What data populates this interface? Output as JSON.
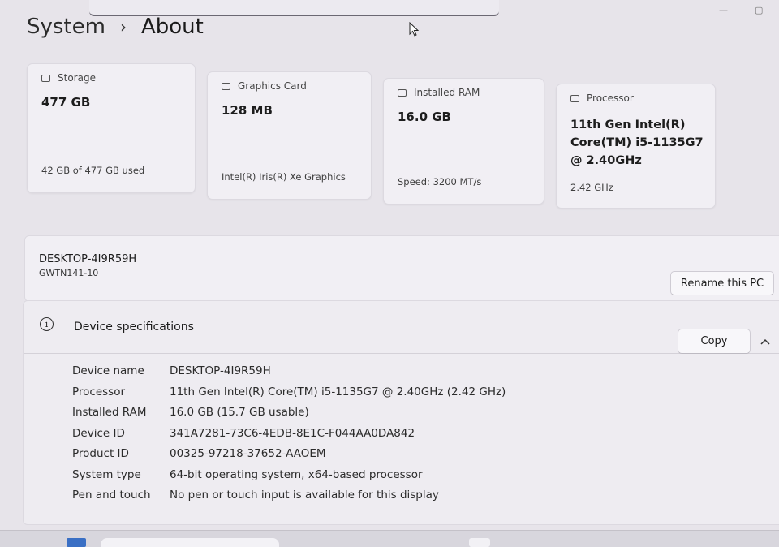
{
  "header": {
    "breadcrumb_parent": "System",
    "breadcrumb_separator": "›",
    "page_title": "About"
  },
  "window_controls": {
    "minimize": "—",
    "maximize": "▢"
  },
  "cards": [
    {
      "icon": "storage-icon",
      "label": "Storage",
      "value": "477 GB",
      "sub": "42 GB of 477 GB used"
    },
    {
      "icon": "graphics-card-icon",
      "label": "Graphics Card",
      "value": "128 MB",
      "sub": "Intel(R) Iris(R) Xe Graphics"
    },
    {
      "icon": "ram-icon",
      "label": "Installed RAM",
      "value": "16.0 GB",
      "sub": "Speed: 3200 MT/s"
    },
    {
      "icon": "processor-icon",
      "label": "Processor",
      "value": "11th Gen Intel(R) Core(TM) i5-1135G7 @ 2.40GHz",
      "sub": "2.42 GHz"
    }
  ],
  "pc": {
    "name": "DESKTOP-4I9R59H",
    "model": "GWTN141-10",
    "rename_label": "Rename this PC"
  },
  "device_specs": {
    "title": "Device specifications",
    "copy_label": "Copy",
    "rows": [
      {
        "label": "Device name",
        "value": "DESKTOP-4I9R59H"
      },
      {
        "label": "Processor",
        "value": "11th Gen Intel(R) Core(TM) i5-1135G7 @ 2.40GHz (2.42 GHz)"
      },
      {
        "label": "Installed RAM",
        "value": "16.0 GB (15.7 GB usable)"
      },
      {
        "label": "Device ID",
        "value": "341A7281-73C6-4EDB-8E1C-F044AA0DA842"
      },
      {
        "label": "Product ID",
        "value": "00325-97218-37652-AAOEM"
      },
      {
        "label": "System type",
        "value": "64-bit operating system, x64-based processor"
      },
      {
        "label": "Pen and touch",
        "value": "No pen or touch input is available for this display"
      }
    ]
  }
}
